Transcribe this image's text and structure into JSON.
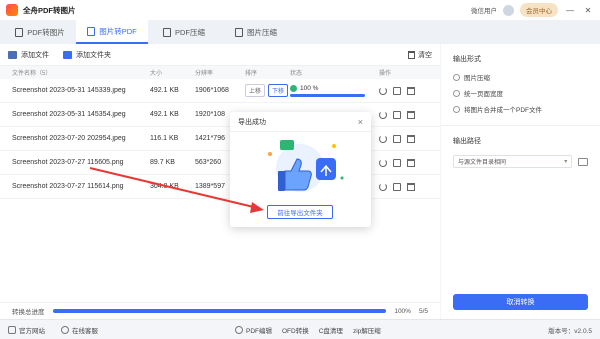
{
  "app": {
    "title": "全舟PDF转图片",
    "user_label": "微信用户",
    "vip_label": "会员中心",
    "minimize": "—",
    "close": "✕"
  },
  "tabs": [
    {
      "label": "PDF转图片",
      "active": false
    },
    {
      "label": "图片转PDF",
      "active": true
    },
    {
      "label": "PDF压缩",
      "active": false
    },
    {
      "label": "图片压缩",
      "active": false
    }
  ],
  "toolbar": {
    "add_file": "添加文件",
    "add_folder": "添加文件夹",
    "clear": "清空"
  },
  "table": {
    "headers": [
      "文件名称（5）",
      "大小",
      "分辨率",
      "排序",
      "状态",
      "操作"
    ],
    "rows": [
      {
        "name": "Screenshot 2023-05-31 145339.jpeg",
        "size": "492.1 KB",
        "res": "1906*1068",
        "up": "上移",
        "down": "下移",
        "status": "100 %"
      },
      {
        "name": "Screenshot 2023-05-31 145354.jpeg",
        "size": "492.1 KB",
        "res": "1920*108",
        "up": "",
        "down": "",
        "status": ""
      },
      {
        "name": "Screenshot 2023-07-20 202954.jpeg",
        "size": "116.1 KB",
        "res": "1421*796",
        "up": "",
        "down": "",
        "status": ""
      },
      {
        "name": "Screenshot 2023-07-27 115605.png",
        "size": "89.7 KB",
        "res": "563*260",
        "up": "",
        "down": "",
        "status": ""
      },
      {
        "name": "Screenshot 2023-07-27 115614.png",
        "size": "304.8 KB",
        "res": "1389*597",
        "up": "",
        "down": "",
        "status": ""
      }
    ]
  },
  "bottom_progress": {
    "label": "转换总进度",
    "value": "100%",
    "count": "5/5",
    "fraction": 1.0
  },
  "side": {
    "output_format_title": "输出形式",
    "options": [
      {
        "label": "图片压缩",
        "selected": false
      },
      {
        "label": "统一页面宽度",
        "selected": false
      },
      {
        "label": "将图片合并成一个PDF文件",
        "selected": false
      }
    ],
    "output_path_title": "输出路径",
    "path_value": "与源文件目录相同",
    "convert_button": "取消转换"
  },
  "statusbar": {
    "left": [
      "官方网站",
      "在线客服"
    ],
    "center": [
      "PDF编辑",
      "OFD转换",
      "C盘清理",
      "zip解压缩"
    ],
    "version": "版本号：v2.0.5"
  },
  "modal": {
    "title": "导出成功",
    "close": "×",
    "button": "前往导出文件夹"
  },
  "colors": {
    "accent": "#3b6cf6",
    "success": "#2bb673",
    "arrow": "#e53935"
  }
}
